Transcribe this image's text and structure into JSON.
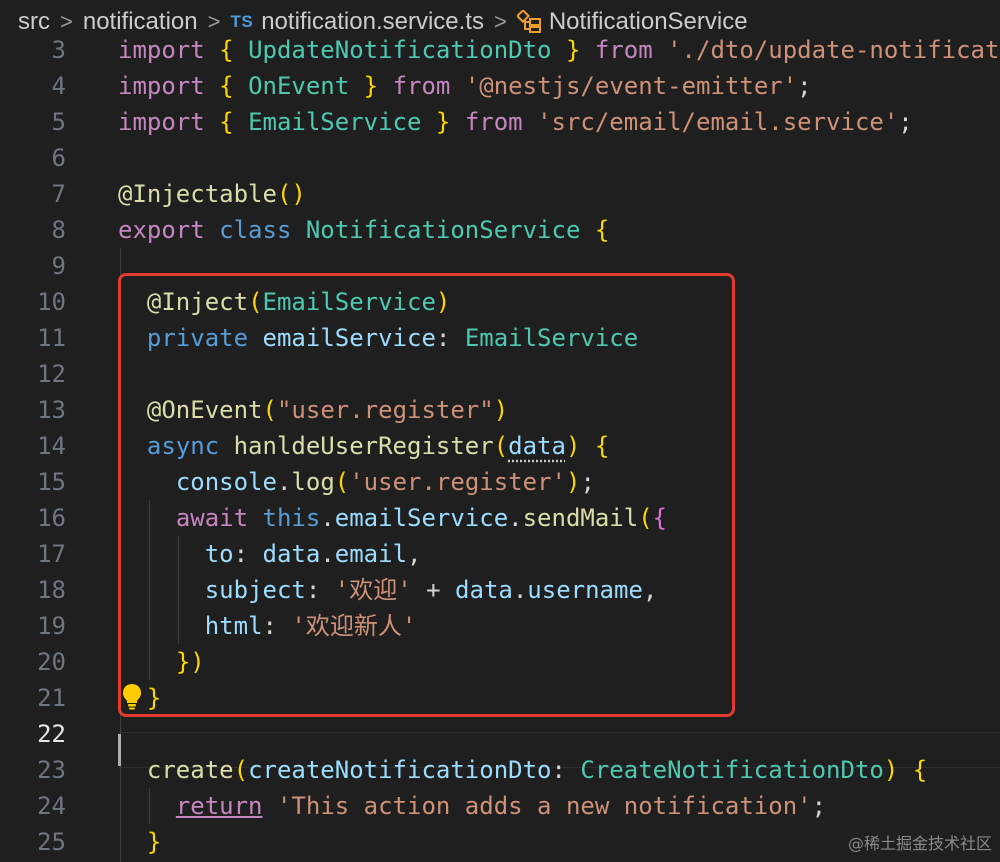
{
  "breadcrumb": {
    "items": [
      "src",
      "notification",
      "notification.service.ts",
      "NotificationService"
    ],
    "file_badge": "TS",
    "separator": ">"
  },
  "editor": {
    "active_line": "22",
    "lines": [
      {
        "n": "3",
        "t": "import { UpdateNotificationDto } from './dto/update-notificat"
      },
      {
        "n": "4",
        "t": "import { OnEvent } from '@nestjs/event-emitter';"
      },
      {
        "n": "5",
        "t": "import { EmailService } from 'src/email/email.service';"
      },
      {
        "n": "6",
        "t": ""
      },
      {
        "n": "7",
        "t": "@Injectable()"
      },
      {
        "n": "8",
        "t": "export class NotificationService {"
      },
      {
        "n": "9",
        "t": ""
      },
      {
        "n": "10",
        "t": "  @Inject(EmailService)"
      },
      {
        "n": "11",
        "t": "  private emailService: EmailService"
      },
      {
        "n": "12",
        "t": ""
      },
      {
        "n": "13",
        "t": "  @OnEvent(\"user.register\")"
      },
      {
        "n": "14",
        "t": "  async hanldeUserRegister(data) {"
      },
      {
        "n": "15",
        "t": "    console.log('user.register');"
      },
      {
        "n": "16",
        "t": "    await this.emailService.sendMail({"
      },
      {
        "n": "17",
        "t": "      to: data.email,"
      },
      {
        "n": "18",
        "t": "      subject: '欢迎' + data.username,"
      },
      {
        "n": "19",
        "t": "      html: '欢迎新人'"
      },
      {
        "n": "20",
        "t": "    })"
      },
      {
        "n": "21",
        "t": "  }"
      },
      {
        "n": "22",
        "t": ""
      },
      {
        "n": "23",
        "t": "  create(createNotificationDto: CreateNotificationDto) {"
      },
      {
        "n": "24",
        "t": "    return 'This action adds a new notification';"
      },
      {
        "n": "25",
        "t": "  }"
      }
    ]
  },
  "annotation": {
    "color": "#e23b2e"
  },
  "icons": {
    "breadcrumb_separator": "chevron-right-icon",
    "symbol": "class-symbol-icon",
    "lightbulb": "lightbulb-icon"
  },
  "watermark": "@稀土掘金技术社区"
}
